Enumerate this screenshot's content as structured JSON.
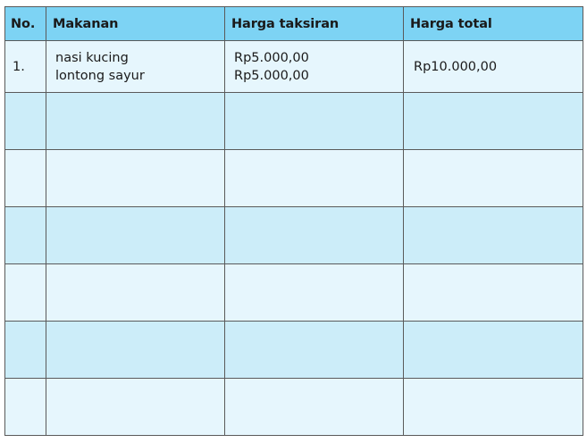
{
  "table": {
    "headers": {
      "no": "No.",
      "food": "Makanan",
      "estimated_price": "Harga taksiran",
      "total_price": "Harga total"
    },
    "rows": [
      {
        "no": "1.",
        "foods": [
          "nasi kucing",
          "lontong sayur"
        ],
        "estimated_prices": [
          "Rp5.000,00",
          "Rp5.000,00"
        ],
        "total": "Rp10.000,00"
      }
    ],
    "empty_row_count": 6
  },
  "colors": {
    "header_bg": "#7dd3f4",
    "row_light": "#e6f6fd",
    "row_dark": "#ccedf9",
    "border": "#5a5a5a"
  }
}
